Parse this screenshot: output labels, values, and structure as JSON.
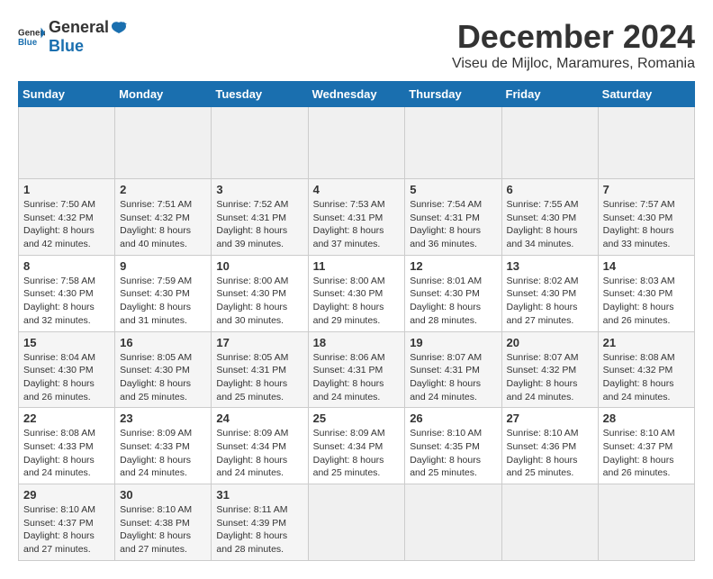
{
  "header": {
    "logo_general": "General",
    "logo_blue": "Blue",
    "month_title": "December 2024",
    "location": "Viseu de Mijloc, Maramures, Romania"
  },
  "calendar": {
    "days_of_week": [
      "Sunday",
      "Monday",
      "Tuesday",
      "Wednesday",
      "Thursday",
      "Friday",
      "Saturday"
    ],
    "weeks": [
      [
        {
          "day": "",
          "empty": true
        },
        {
          "day": "",
          "empty": true
        },
        {
          "day": "",
          "empty": true
        },
        {
          "day": "",
          "empty": true
        },
        {
          "day": "",
          "empty": true
        },
        {
          "day": "",
          "empty": true
        },
        {
          "day": "",
          "empty": true
        }
      ],
      [
        {
          "day": "1",
          "sunrise": "7:50 AM",
          "sunset": "4:32 PM",
          "daylight": "8 hours and 42 minutes."
        },
        {
          "day": "2",
          "sunrise": "7:51 AM",
          "sunset": "4:32 PM",
          "daylight": "8 hours and 40 minutes."
        },
        {
          "day": "3",
          "sunrise": "7:52 AM",
          "sunset": "4:31 PM",
          "daylight": "8 hours and 39 minutes."
        },
        {
          "day": "4",
          "sunrise": "7:53 AM",
          "sunset": "4:31 PM",
          "daylight": "8 hours and 37 minutes."
        },
        {
          "day": "5",
          "sunrise": "7:54 AM",
          "sunset": "4:31 PM",
          "daylight": "8 hours and 36 minutes."
        },
        {
          "day": "6",
          "sunrise": "7:55 AM",
          "sunset": "4:30 PM",
          "daylight": "8 hours and 34 minutes."
        },
        {
          "day": "7",
          "sunrise": "7:57 AM",
          "sunset": "4:30 PM",
          "daylight": "8 hours and 33 minutes."
        }
      ],
      [
        {
          "day": "8",
          "sunrise": "7:58 AM",
          "sunset": "4:30 PM",
          "daylight": "8 hours and 32 minutes."
        },
        {
          "day": "9",
          "sunrise": "7:59 AM",
          "sunset": "4:30 PM",
          "daylight": "8 hours and 31 minutes."
        },
        {
          "day": "10",
          "sunrise": "8:00 AM",
          "sunset": "4:30 PM",
          "daylight": "8 hours and 30 minutes."
        },
        {
          "day": "11",
          "sunrise": "8:00 AM",
          "sunset": "4:30 PM",
          "daylight": "8 hours and 29 minutes."
        },
        {
          "day": "12",
          "sunrise": "8:01 AM",
          "sunset": "4:30 PM",
          "daylight": "8 hours and 28 minutes."
        },
        {
          "day": "13",
          "sunrise": "8:02 AM",
          "sunset": "4:30 PM",
          "daylight": "8 hours and 27 minutes."
        },
        {
          "day": "14",
          "sunrise": "8:03 AM",
          "sunset": "4:30 PM",
          "daylight": "8 hours and 26 minutes."
        }
      ],
      [
        {
          "day": "15",
          "sunrise": "8:04 AM",
          "sunset": "4:30 PM",
          "daylight": "8 hours and 26 minutes."
        },
        {
          "day": "16",
          "sunrise": "8:05 AM",
          "sunset": "4:30 PM",
          "daylight": "8 hours and 25 minutes."
        },
        {
          "day": "17",
          "sunrise": "8:05 AM",
          "sunset": "4:31 PM",
          "daylight": "8 hours and 25 minutes."
        },
        {
          "day": "18",
          "sunrise": "8:06 AM",
          "sunset": "4:31 PM",
          "daylight": "8 hours and 24 minutes."
        },
        {
          "day": "19",
          "sunrise": "8:07 AM",
          "sunset": "4:31 PM",
          "daylight": "8 hours and 24 minutes."
        },
        {
          "day": "20",
          "sunrise": "8:07 AM",
          "sunset": "4:32 PM",
          "daylight": "8 hours and 24 minutes."
        },
        {
          "day": "21",
          "sunrise": "8:08 AM",
          "sunset": "4:32 PM",
          "daylight": "8 hours and 24 minutes."
        }
      ],
      [
        {
          "day": "22",
          "sunrise": "8:08 AM",
          "sunset": "4:33 PM",
          "daylight": "8 hours and 24 minutes."
        },
        {
          "day": "23",
          "sunrise": "8:09 AM",
          "sunset": "4:33 PM",
          "daylight": "8 hours and 24 minutes."
        },
        {
          "day": "24",
          "sunrise": "8:09 AM",
          "sunset": "4:34 PM",
          "daylight": "8 hours and 24 minutes."
        },
        {
          "day": "25",
          "sunrise": "8:09 AM",
          "sunset": "4:34 PM",
          "daylight": "8 hours and 25 minutes."
        },
        {
          "day": "26",
          "sunrise": "8:10 AM",
          "sunset": "4:35 PM",
          "daylight": "8 hours and 25 minutes."
        },
        {
          "day": "27",
          "sunrise": "8:10 AM",
          "sunset": "4:36 PM",
          "daylight": "8 hours and 25 minutes."
        },
        {
          "day": "28",
          "sunrise": "8:10 AM",
          "sunset": "4:37 PM",
          "daylight": "8 hours and 26 minutes."
        }
      ],
      [
        {
          "day": "29",
          "sunrise": "8:10 AM",
          "sunset": "4:37 PM",
          "daylight": "8 hours and 27 minutes."
        },
        {
          "day": "30",
          "sunrise": "8:10 AM",
          "sunset": "4:38 PM",
          "daylight": "8 hours and 27 minutes."
        },
        {
          "day": "31",
          "sunrise": "8:11 AM",
          "sunset": "4:39 PM",
          "daylight": "8 hours and 28 minutes."
        },
        {
          "day": "",
          "empty": true
        },
        {
          "day": "",
          "empty": true
        },
        {
          "day": "",
          "empty": true
        },
        {
          "day": "",
          "empty": true
        }
      ]
    ]
  }
}
